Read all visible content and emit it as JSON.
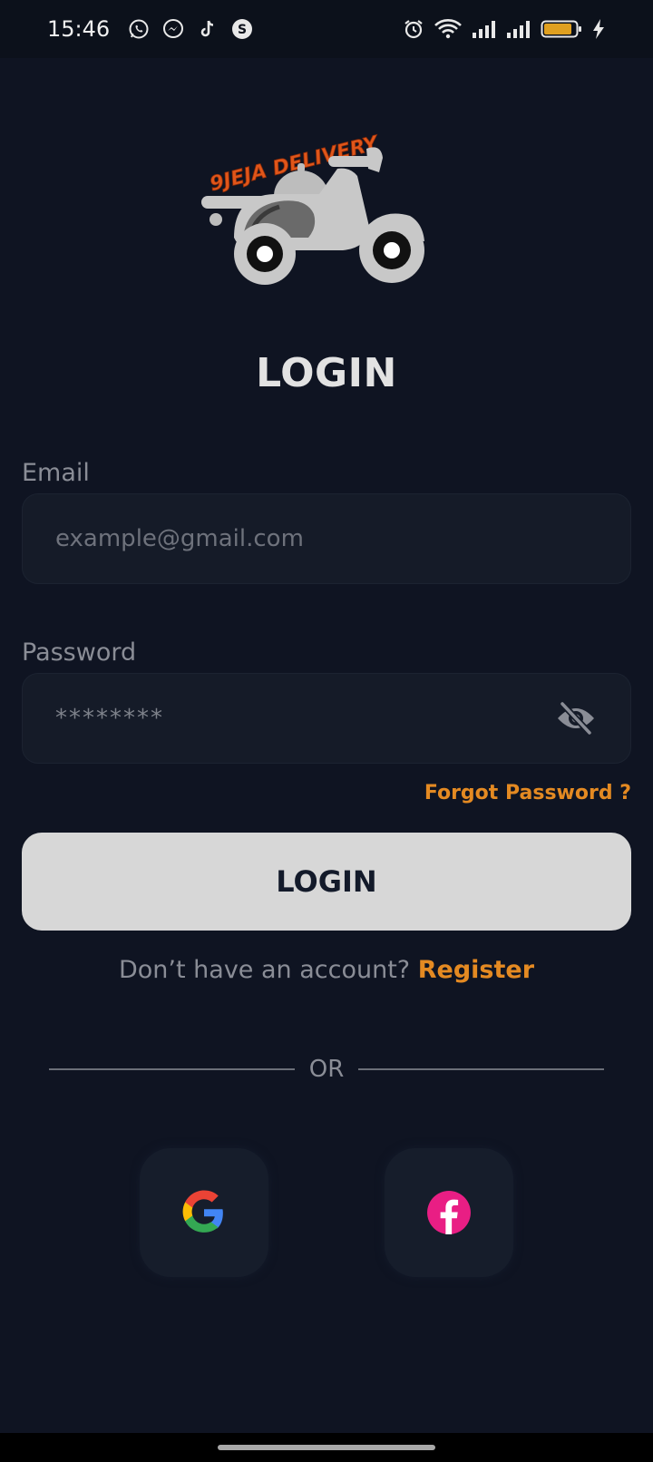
{
  "status_bar": {
    "time": "15:46",
    "left_icons": [
      "whatsapp-icon",
      "messenger-icon",
      "tiktok-icon",
      "threads-icon"
    ],
    "right_icons": [
      "alarm-icon",
      "wifi-icon",
      "signal-icon",
      "signal-icon",
      "battery-icon",
      "charging-icon"
    ],
    "battery_color": "#e0a020"
  },
  "logo": {
    "text": "9JEJA DELIVERY",
    "icon": "scooter-delivery-icon",
    "text_color": "#e0561a"
  },
  "title": "LOGIN",
  "email": {
    "label": "Email",
    "placeholder": "example@gmail.com",
    "value": ""
  },
  "password": {
    "label": "Password",
    "placeholder": "********",
    "value": "",
    "toggle_icon": "eye-off-icon"
  },
  "forgot_password": "Forgot Password ?",
  "login_button": "LOGIN",
  "register": {
    "prompt": "Don’t have an account?",
    "link": "Register"
  },
  "divider_text": "OR",
  "social": {
    "google_icon": "google-icon",
    "facebook_icon": "facebook-icon"
  },
  "colors": {
    "background": "#0f1422",
    "accent": "#e48a22",
    "button": "#d7d7d7"
  }
}
